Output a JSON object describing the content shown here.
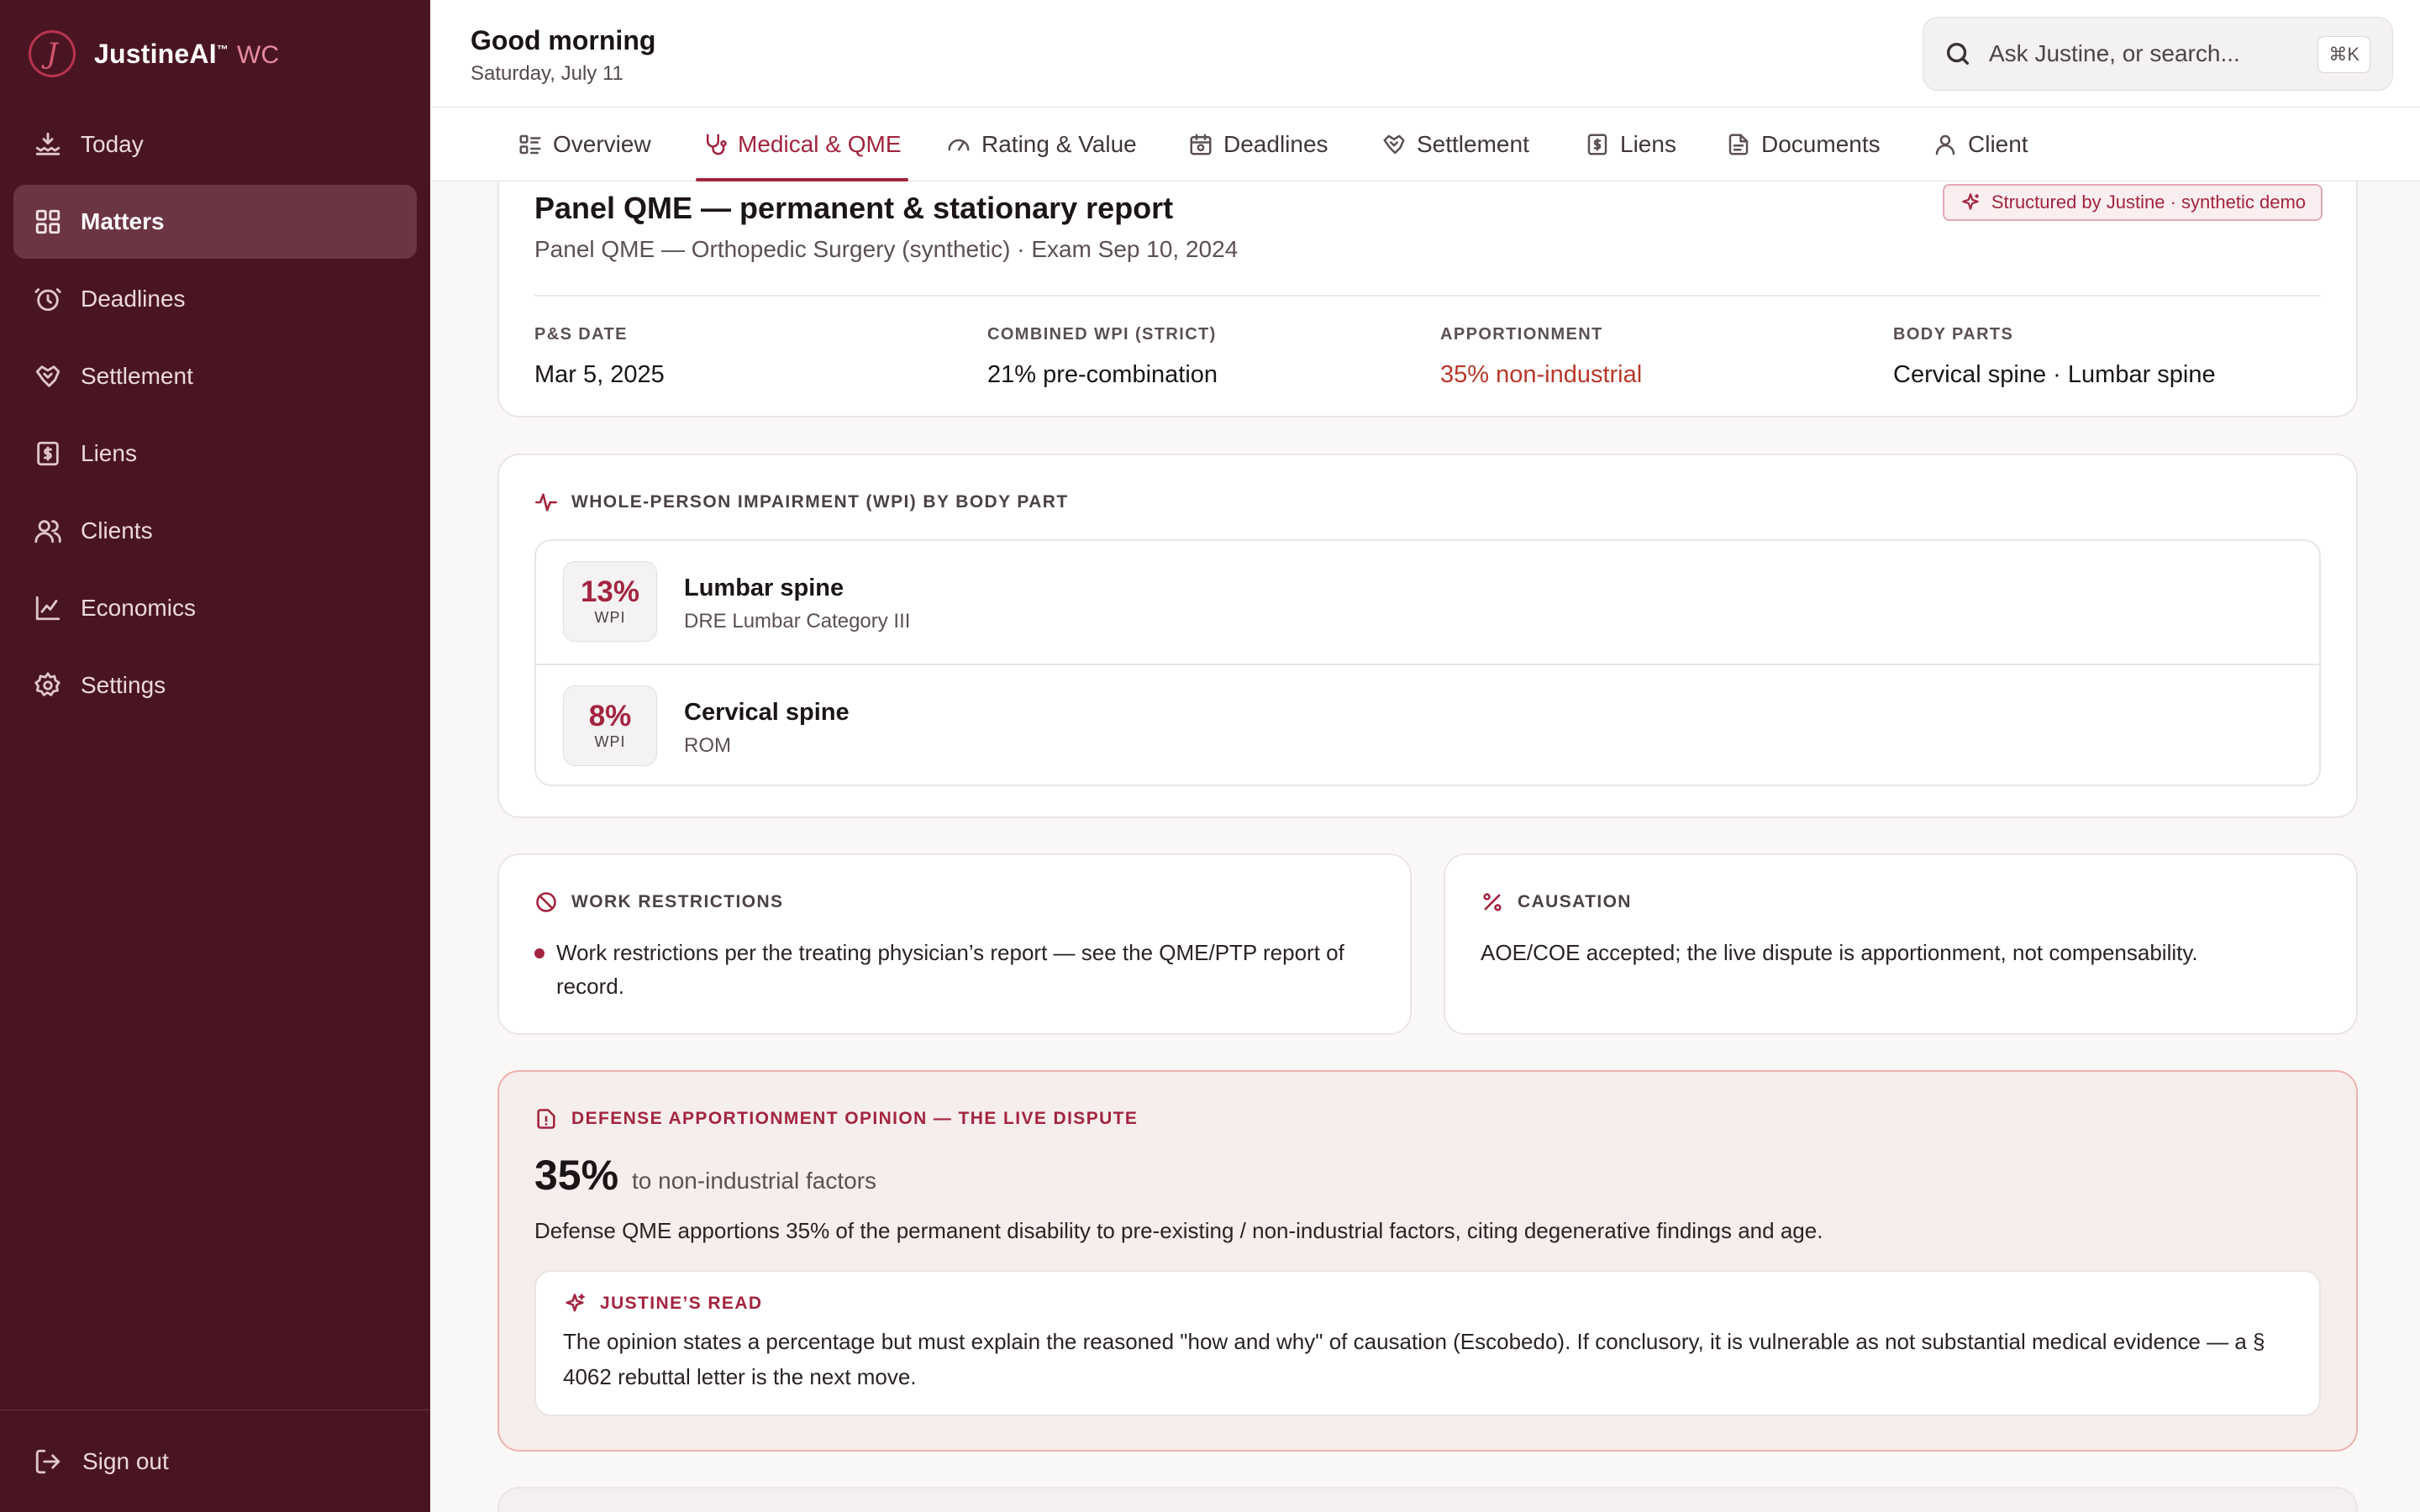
{
  "app": {
    "brand_name": "JustineAI",
    "brand_tm": "™",
    "brand_sub": "WC",
    "brand_initial": "J"
  },
  "sidebar": {
    "items": [
      {
        "label": "Today",
        "icon": "today-icon"
      },
      {
        "label": "Matters",
        "icon": "grid-icon",
        "active": true
      },
      {
        "label": "Deadlines",
        "icon": "alarm-clock-icon"
      },
      {
        "label": "Settlement",
        "icon": "handshake-icon"
      },
      {
        "label": "Liens",
        "icon": "dollar-document-icon"
      },
      {
        "label": "Clients",
        "icon": "users-icon"
      },
      {
        "label": "Economics",
        "icon": "line-chart-icon"
      },
      {
        "label": "Settings",
        "icon": "gear-icon"
      }
    ],
    "signout_label": "Sign out"
  },
  "header": {
    "greeting": "Good morning",
    "date": "Saturday, July 11",
    "search_placeholder": "Ask Justine, or search...",
    "search_value": "",
    "search_shortcut": "⌘K"
  },
  "tabs": [
    {
      "label": "Overview",
      "icon": "list-icon"
    },
    {
      "label": "Medical & QME",
      "icon": "stethoscope-icon",
      "active": true
    },
    {
      "label": "Rating & Value",
      "icon": "gauge-icon"
    },
    {
      "label": "Deadlines",
      "icon": "calendar-icon"
    },
    {
      "label": "Settlement",
      "icon": "handshake-icon"
    },
    {
      "label": "Liens",
      "icon": "dollar-document-icon"
    },
    {
      "label": "Documents",
      "icon": "document-icon"
    },
    {
      "label": "Client",
      "icon": "user-icon"
    }
  ],
  "report": {
    "title": "Panel QME — permanent & stationary report",
    "subtitle": "Panel QME — Orthopedic Surgery (synthetic) · Exam Sep 10, 2024",
    "badge": "Structured by Justine · synthetic demo",
    "stats": [
      {
        "label": "P&S DATE",
        "value": "Mar 5, 2025"
      },
      {
        "label": "COMBINED WPI (STRICT)",
        "value": "21% pre-combination"
      },
      {
        "label": "APPORTIONMENT",
        "value": "35% non-industrial",
        "color": "#b9382a"
      },
      {
        "label": "BODY PARTS",
        "value": "Cervical spine · Lumbar spine"
      }
    ]
  },
  "wpi": {
    "heading": "WHOLE-PERSON IMPAIRMENT (WPI) BY BODY PART",
    "unit": "WPI",
    "rows": [
      {
        "pct": "13%",
        "name": "Lumbar spine",
        "desc": "DRE Lumbar Category III"
      },
      {
        "pct": "8%",
        "name": "Cervical spine",
        "desc": "ROM"
      }
    ]
  },
  "restrictions": {
    "heading": "WORK RESTRICTIONS",
    "items": [
      "Work restrictions per the treating physician’s report — see the QME/PTP report of record."
    ]
  },
  "causation": {
    "heading": "CAUSATION",
    "text": "AOE/COE accepted; the live dispute is apportionment, not compensability."
  },
  "defense": {
    "heading": "DEFENSE APPORTIONMENT OPINION — THE LIVE DISPUTE",
    "pct": "35%",
    "pct_sub": "to non-industrial factors",
    "text": "Defense QME apportions 35% of the permanent disability to pre-existing / non-industrial factors, citing degenerative findings and age.",
    "read_heading": "JUSTINE’S READ",
    "read_text": "The opinion states a percentage but must explain the reasoned \"how and why\" of causation (Escobedo). If conclusory, it is vulnerable as not substantial medical evidence — a § 4062 rebuttal letter is the next move."
  },
  "colors": {
    "sidebar_bg": "#4a1523",
    "accent": "#a3243f",
    "warning_text": "#b9382a",
    "defense_bg": "#f6eeec"
  }
}
